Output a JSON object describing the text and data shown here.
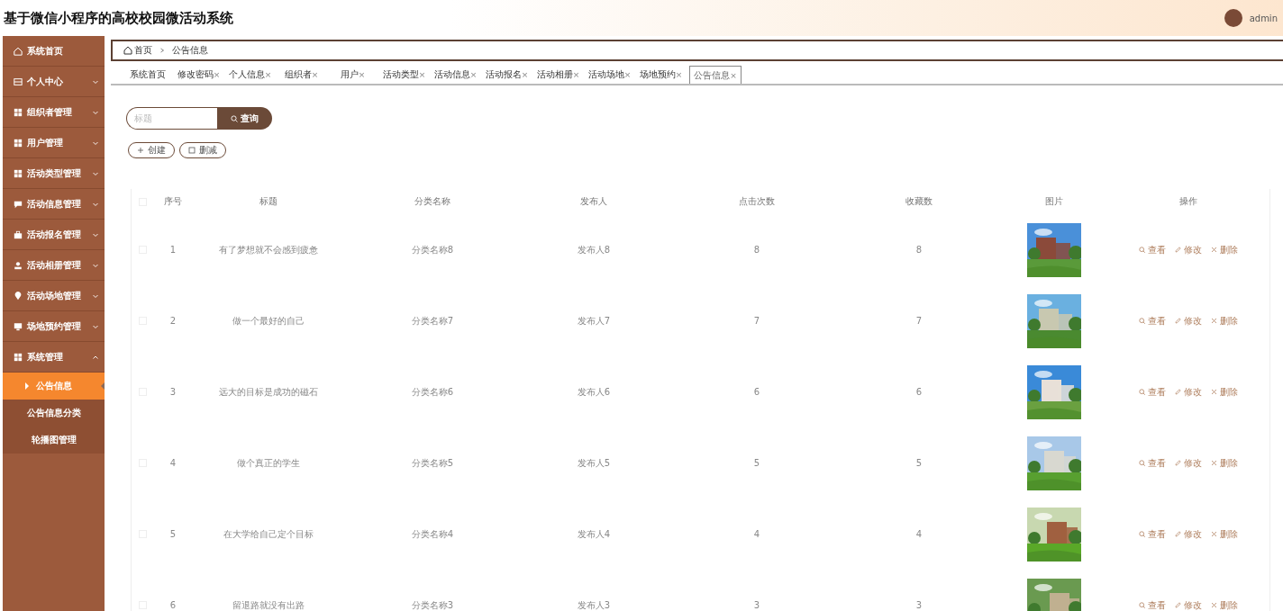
{
  "header": {
    "title": "基于微信小程序的高校校园微活动系统",
    "user": "admin"
  },
  "sidebar": {
    "items": [
      {
        "label": "系统首页"
      },
      {
        "label": "个人中心",
        "expanded": false
      },
      {
        "label": "组织者管理",
        "expanded": false
      },
      {
        "label": "用户管理",
        "expanded": false
      },
      {
        "label": "活动类型管理",
        "expanded": false
      },
      {
        "label": "活动信息管理",
        "expanded": false
      },
      {
        "label": "活动报名管理",
        "expanded": false
      },
      {
        "label": "活动相册管理",
        "expanded": false
      },
      {
        "label": "活动场地管理",
        "expanded": false
      },
      {
        "label": "场地预约管理",
        "expanded": false
      },
      {
        "label": "系统管理",
        "expanded": true,
        "children": [
          {
            "label": "公告信息",
            "selected": true
          },
          {
            "label": "公告信息分类",
            "selected": false
          },
          {
            "label": "轮播图管理",
            "selected": false
          }
        ]
      }
    ]
  },
  "breadcrumb": [
    "首页",
    "公告信息"
  ],
  "tabs": [
    {
      "label": "系统首页",
      "selected": false
    },
    {
      "label": "修改密码",
      "close": "×",
      "selected": false
    },
    {
      "label": "个人信息",
      "close": "×",
      "selected": false
    },
    {
      "label": "组织者",
      "close": "×",
      "selected": false
    },
    {
      "label": "用户",
      "close": "×",
      "selected": false
    },
    {
      "label": "活动类型",
      "close": "×",
      "selected": false
    },
    {
      "label": "活动信息",
      "close": "×",
      "selected": false
    },
    {
      "label": "活动报名",
      "close": "×",
      "selected": false
    },
    {
      "label": "活动相册",
      "close": "×",
      "selected": false
    },
    {
      "label": "活动场地",
      "close": "×",
      "selected": false
    },
    {
      "label": "场地预约",
      "close": "×",
      "selected": false
    },
    {
      "label": "公告信息",
      "close": "×",
      "selected": true
    }
  ],
  "search": {
    "placeholder": "标题",
    "button": "查询"
  },
  "actions": [
    "创建",
    "删减"
  ],
  "table": {
    "all_checked": false,
    "columns": [
      "序号",
      "标题",
      "分类名称",
      "发布人",
      "点击次数",
      "收藏数",
      "图片",
      "操作"
    ],
    "rows": [
      {
        "checked": false,
        "cells": [
          "1",
          "有了梦想就不会感到疲惫",
          "分类名称8",
          "发布人8",
          "8",
          "8"
        ],
        "actions": [
          "查看",
          "修改",
          "删除"
        ]
      },
      {
        "checked": false,
        "cells": [
          "2",
          "做一个最好的自己",
          "分类名称7",
          "发布人7",
          "7",
          "7"
        ],
        "actions": [
          "查看",
          "修改",
          "删除"
        ]
      },
      {
        "checked": false,
        "cells": [
          "3",
          "远大的目标是成功的磁石",
          "分类名称6",
          "发布人6",
          "6",
          "6"
        ],
        "actions": [
          "查看",
          "修改",
          "删除"
        ]
      },
      {
        "checked": false,
        "cells": [
          "4",
          "做个真正的学生",
          "分类名称5",
          "发布人5",
          "5",
          "5"
        ],
        "actions": [
          "查看",
          "修改",
          "删除"
        ]
      },
      {
        "checked": false,
        "cells": [
          "5",
          "在大学给自己定个目标",
          "分类名称4",
          "发布人4",
          "4",
          "4"
        ],
        "actions": [
          "查看",
          "修改",
          "删除"
        ]
      },
      {
        "checked": false,
        "cells": [
          "6",
          "留退路就没有出路",
          "分类名称3",
          "发布人3",
          "3",
          "3"
        ],
        "actions": [
          "查看",
          "修改",
          "删除"
        ]
      }
    ]
  }
}
